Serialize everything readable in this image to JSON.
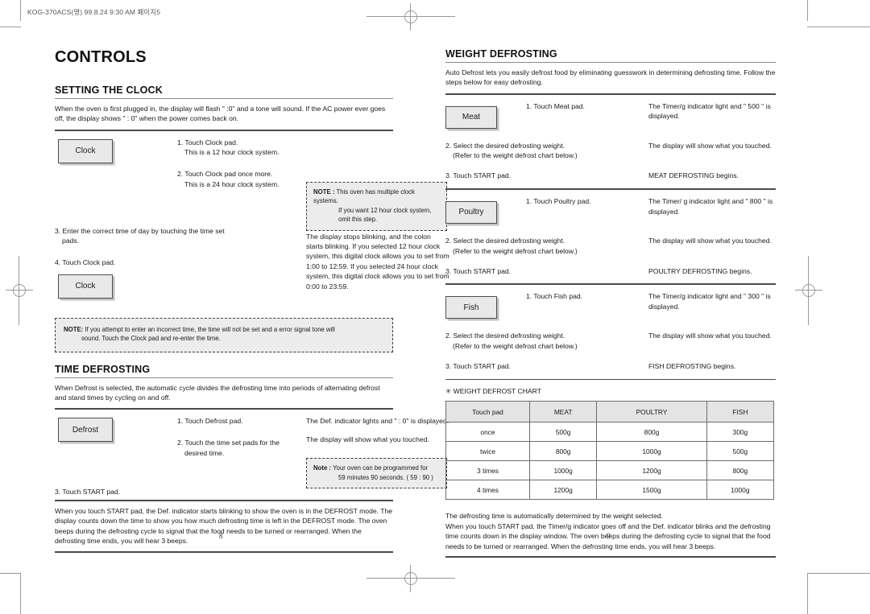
{
  "document": {
    "print_header": "KOG-370ACS(영) 99.8.24 9:30 AM  페이지5",
    "left_page_number": "8",
    "right_page_number": "9"
  },
  "left": {
    "title": "CONTROLS",
    "clock_section": {
      "heading": "SETTING THE CLOCK",
      "intro": "When the oven is first plugged in, the display will flash \" :0\" and a tone will sound. If the AC power ever goes off, the display shows \" : 0\" when the power comes back on.",
      "pad1_label": "Clock",
      "pad2_label": "Clock",
      "step1": "1.  Touch Clock pad.",
      "step1_sub": "This is a 12 hour clock system.",
      "step2": "2. Touch Clock pad once more.",
      "step2_sub": "This is a 24 hour clock system.",
      "step3": "3. Enter the correct time of day by touching the time set",
      "step3_sub": "pads.",
      "step4": "4. Touch Clock pad.",
      "note_top_label": "NOTE :",
      "note_top_line1": "This oven has multiple clock systems.",
      "note_top_line2": "If you want 12 hour clock system,",
      "note_top_line3": "omit this step.",
      "result_text": "The display stops blinking, and the colon starts blinking. If you selected 12 hour clock system, this digital clock allows you to set from 1:00 to 12:59. If you selected 24 hour clock system, this digital clock allows you to set from 0:00 to 23:59.",
      "note_bottom_label": "NOTE:",
      "note_bottom_line1": "If you attempt to enter an incorrect time, the time will not be set and a error signal tone will",
      "note_bottom_line2": "sound. Touch the Clock pad and re-enter the time."
    },
    "time_defrost_section": {
      "heading": "TIME DEFROSTING",
      "intro": "When Defrost is selected, the automatic cycle divides the defrosting time into periods of alternating defrost and stand times by cycling on and off.",
      "pad_label": "Defrost",
      "step1": "1. Touch Defrost pad.",
      "step1_result": "The Def. indicator lights and \" : 0\" is displayed.",
      "step2": "2. Touch the time set pads for the",
      "step2_sub": "desired time.",
      "step2_result": "The display will show what you touched.",
      "note_label": "Note :",
      "note_line1": "Your oven can be programmed for",
      "note_line2": "59 minutes 90 seconds. ( 59 : 90 )",
      "step3": "3. Touch START pad.",
      "closing": "When you touch START pad, the Def. indicator starts blinking to show the oven is in the DEFROST mode. The display counts down the time to show you how much defrosting time is left in the DEFROST mode. The oven beeps during the defrosting cycle to signal that the food needs to be turned or rearranged. When the defrosting time ends, you will hear 3 beeps."
    }
  },
  "right": {
    "heading": "WEIGHT DEFROSTING",
    "intro": "Auto Defrost lets you easily defrost food by eliminating guesswork in determining defrosting time. Follow the steps below for easy defrosting.",
    "groups": [
      {
        "pad_label": "Meat",
        "step1": "1. Touch Meat pad.",
        "step1_result": "The Timer/g indicator light and \" 500 \" is displayed.",
        "step2": "2. Select the desired defrosting weight.",
        "step2_sub": "(Refer to the weight defrost chart below.)",
        "step2_result": "The display will show what you touched.",
        "step3": "3. Touch START pad.",
        "step3_result": "MEAT DEFROSTING begins."
      },
      {
        "pad_label": "Poultry",
        "step1": "1. Touch Poultry pad.",
        "step1_result": "The Timer/ g indicator light and \" 800 \" is displayed.",
        "step2": "2. Select the desired defrosting weight.",
        "step2_sub": "(Refer to the weight defrost chart below.)",
        "step2_result": "The display will show what you touched.",
        "step3": "3. Touch START pad.",
        "step3_result": "POULTRY DEFROSTING begins."
      },
      {
        "pad_label": "Fish",
        "step1": "1. Touch Fish pad.",
        "step1_result": "The Timer/g indicator light and \" 300 \" is displayed.",
        "step2": "2. Select the desired defrosting weight.",
        "step2_sub": "(Refer to the weight defrost chart below.)",
        "step2_result": "The display will show what you touched.",
        "step3": "3. Touch START pad.",
        "step3_result": "FISH DEFROSTING begins."
      }
    ],
    "chart_label": "WEIGHT DEFROST CHART",
    "chart_label_bullet": "✳",
    "closing_line1": "The defrosting time is automatically determined by the weight selected.",
    "closing_rest": "When you touch START pad, the Timer/g indicator goes off and the Def. indicator blinks and the defrosting time counts down in the display window. The oven beeps during the defrosting cycle to signal that the food needs to be turned or rearranged. When the defrosting time ends, you will hear 3 beeps."
  },
  "chart_data": {
    "type": "table",
    "title": "WEIGHT DEFROST CHART",
    "columns": [
      "Touch pad",
      "MEAT",
      "POULTRY",
      "FISH"
    ],
    "rows": [
      [
        "once",
        "500g",
        "800g",
        "300g"
      ],
      [
        "twice",
        "800g",
        "1000g",
        "500g"
      ],
      [
        "3 times",
        "1000g",
        "1200g",
        "800g"
      ],
      [
        "4 times",
        "1200g",
        "1500g",
        "1000g"
      ]
    ]
  }
}
